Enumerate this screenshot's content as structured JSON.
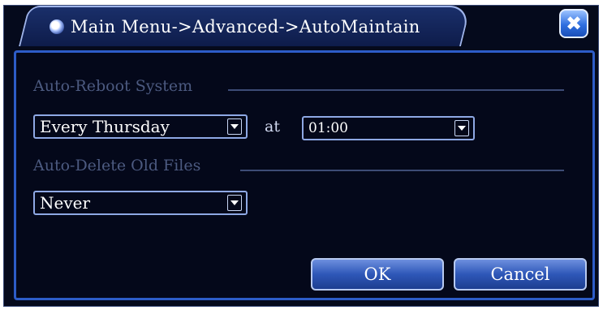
{
  "window": {
    "title": "Main Menu->Advanced->AutoMaintain",
    "title_icon": "globe-icon",
    "close_icon": "close-icon",
    "close_glyph": "✖"
  },
  "reboot": {
    "section_label": "Auto-Reboot System",
    "schedule_value": "Every Thursday",
    "at_label": "at",
    "time_value": "01:00"
  },
  "delete": {
    "section_label": "Auto-Delete Old Files",
    "value": "Never"
  },
  "buttons": {
    "ok_label": "OK",
    "cancel_label": "Cancel"
  },
  "colors": {
    "background": "#04081a",
    "border_accent": "#2d5cc8",
    "button_blue": "#2e57b8"
  }
}
